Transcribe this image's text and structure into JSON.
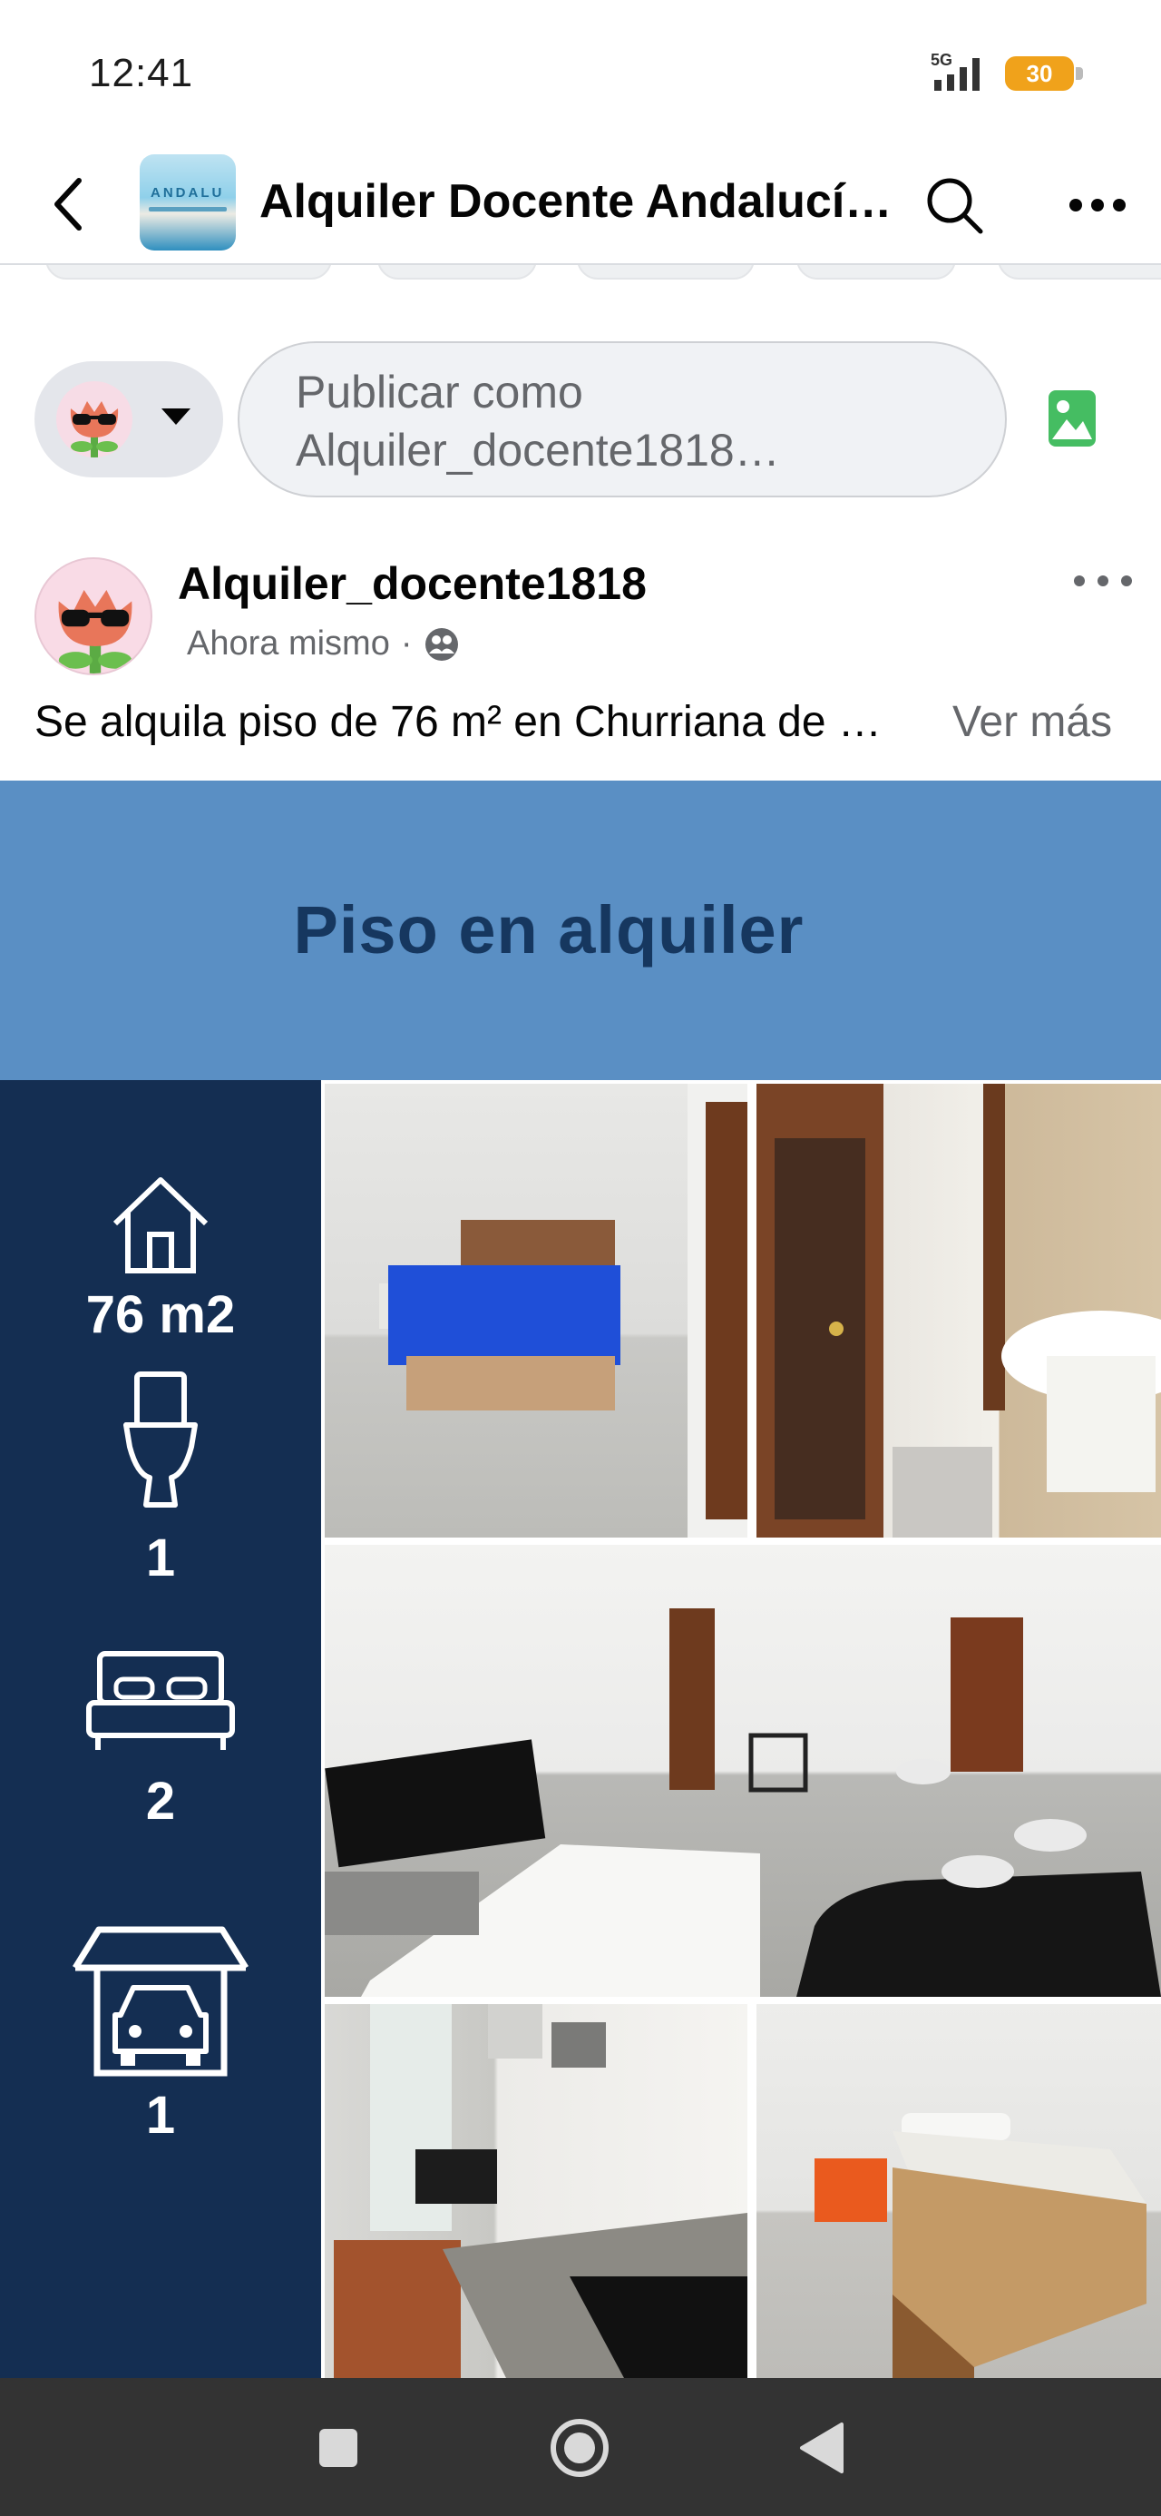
{
  "status_bar": {
    "time": "12:41",
    "network": "5G",
    "battery": "30"
  },
  "header": {
    "group_title": "Alquiler Docente Andalucí…",
    "group_avatar_text": "ANDALU"
  },
  "composer": {
    "placeholder_line1": "Publicar como",
    "placeholder_line2": "Alquiler_docente1818…"
  },
  "post": {
    "author": "Alquiler_docente1818",
    "time": "Ahora mismo",
    "separator": "·",
    "text": "Se alquila piso de 76 m²  en Churriana de …",
    "see_more": "Ver más"
  },
  "post_image": {
    "title": "Piso en alquiler",
    "features": [
      {
        "icon": "house-icon",
        "value": "76 m2"
      },
      {
        "icon": "toilet-icon",
        "value": "1"
      },
      {
        "icon": "bed-icon",
        "value": "2"
      },
      {
        "icon": "garage-car-icon",
        "value": "1"
      }
    ],
    "photos": [
      "bedroom-photo",
      "bathroom-photo",
      "living-room-photo",
      "kitchen-photo",
      "single-bedroom-photo"
    ],
    "colors": {
      "banner": "#5a8fc4",
      "sidebar": "#142e52",
      "title": "#16375f"
    }
  },
  "nav": {
    "buttons": [
      "recents-button",
      "home-button",
      "back-button"
    ]
  }
}
